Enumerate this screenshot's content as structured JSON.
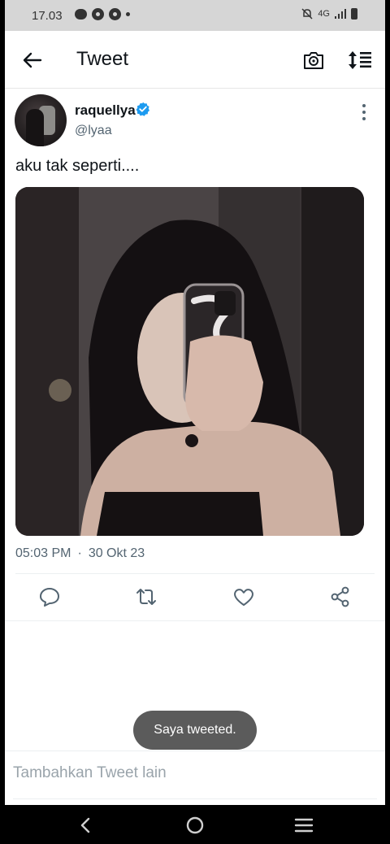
{
  "status_bar": {
    "time": "17.03",
    "network": "4G"
  },
  "header": {
    "title": "Tweet",
    "back_icon": "arrow-left-icon",
    "camera_icon": "camera-icon",
    "sort_icon": "sort-icon"
  },
  "tweet": {
    "user_name": "raquellya",
    "handle": "@lyaa",
    "verified": true,
    "text": "aku tak seperti....",
    "time": "05:03 PM",
    "separator": "·",
    "date": "30 Okt 23"
  },
  "actions": [
    {
      "name": "reply",
      "icon": "reply-icon"
    },
    {
      "name": "retweet",
      "icon": "retweet-icon"
    },
    {
      "name": "like",
      "icon": "heart-icon"
    },
    {
      "name": "share",
      "icon": "share-icon"
    }
  ],
  "toast": {
    "text": "Saya tweeted."
  },
  "reply_field": {
    "placeholder": "Tambahkan Tweet lain"
  },
  "colors": {
    "accent": "#1d9bf0",
    "secondary_text": "#536471",
    "toast_bg": "#5b5b5b"
  }
}
